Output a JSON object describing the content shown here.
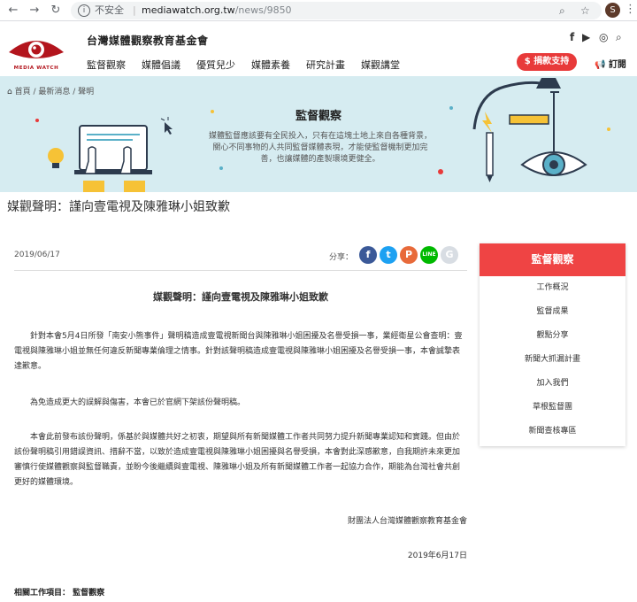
{
  "browser": {
    "insecure_label": "不安全",
    "url_host": "mediawatch.org.tw",
    "url_path": "/news/9850",
    "avatar_letter": "S"
  },
  "site": {
    "logo_text": "MEDIA WATCH",
    "org_name": "台灣媒體觀察教育基金會",
    "nav": [
      "監督觀察",
      "媒體倡議",
      "優質兒少",
      "媒體素養",
      "研究計畫",
      "媒觀講堂"
    ],
    "donate_label": "$ 捐款支持",
    "subscribe_label": "訂閱",
    "brand_color": "#e83a3a"
  },
  "breadcrumb": [
    "首頁",
    "最新消息",
    "聲明"
  ],
  "banner": {
    "title": "監督觀察",
    "description": "媒體監督應該要有全民投入，只有在這塊土地上來自各種背景，關心不同事物的人共同監督媒體表現，才能使監督機制更加完善，也讓媒體的產製環境更健全。",
    "bg_color": "#d6ecf1"
  },
  "page_title": "媒觀聲明：謹向壹電視及陳雅琳小姐致歉",
  "article": {
    "date": "2019/06/17",
    "share_label": "分享：",
    "title": "媒觀聲明：謹向壹電視及陳雅琳小姐致歉",
    "paragraphs": [
      "針對本會5月4日所發「南安小熊事件」聲明稿造成壹電視新聞台與陳雅琳小姐困擾及名譽受損一事，業經衛星公會查明：壹電視與陳雅琳小姐並無任何違反新聞專業倫理之情事。針對該聲明稿造成壹電視與陳雅琳小姐困擾及名譽受損一事，本會誠摯表達歉意。",
      "為免造成更大的誤解與傷害，本會已於官網下架該份聲明稿。",
      "本會此前發布該份聲明，係基於與媒體共好之初衷，期望與所有新聞媒體工作者共同努力提升新聞專業認知和實踐。但由於該份聲明稿引用錯誤資訊、措辭不當，以致於造成壹電視與陳雅琳小姐困擾與名譽受損，本會對此深感歉意，自我期許未來更加審慎行使媒體觀察與監督職責，並盼今後繼續與壹電視、陳雅琳小姐及所有新聞媒體工作者一起協力合作，期能為台灣社會共創更好的媒體環境。"
    ],
    "signature": "財團法人台灣媒體觀察教育基金會",
    "signature_date": "2019年6月17日",
    "related_label": "相關工作項目： 監督觀察"
  },
  "sidebar": {
    "header": "監督觀察",
    "items": [
      "工作概況",
      "監督成果",
      "觀點分享",
      "新聞大抓漏計畫",
      "加入我們",
      "草根監督團",
      "新聞查核專區"
    ],
    "header_color": "#ef4444"
  }
}
